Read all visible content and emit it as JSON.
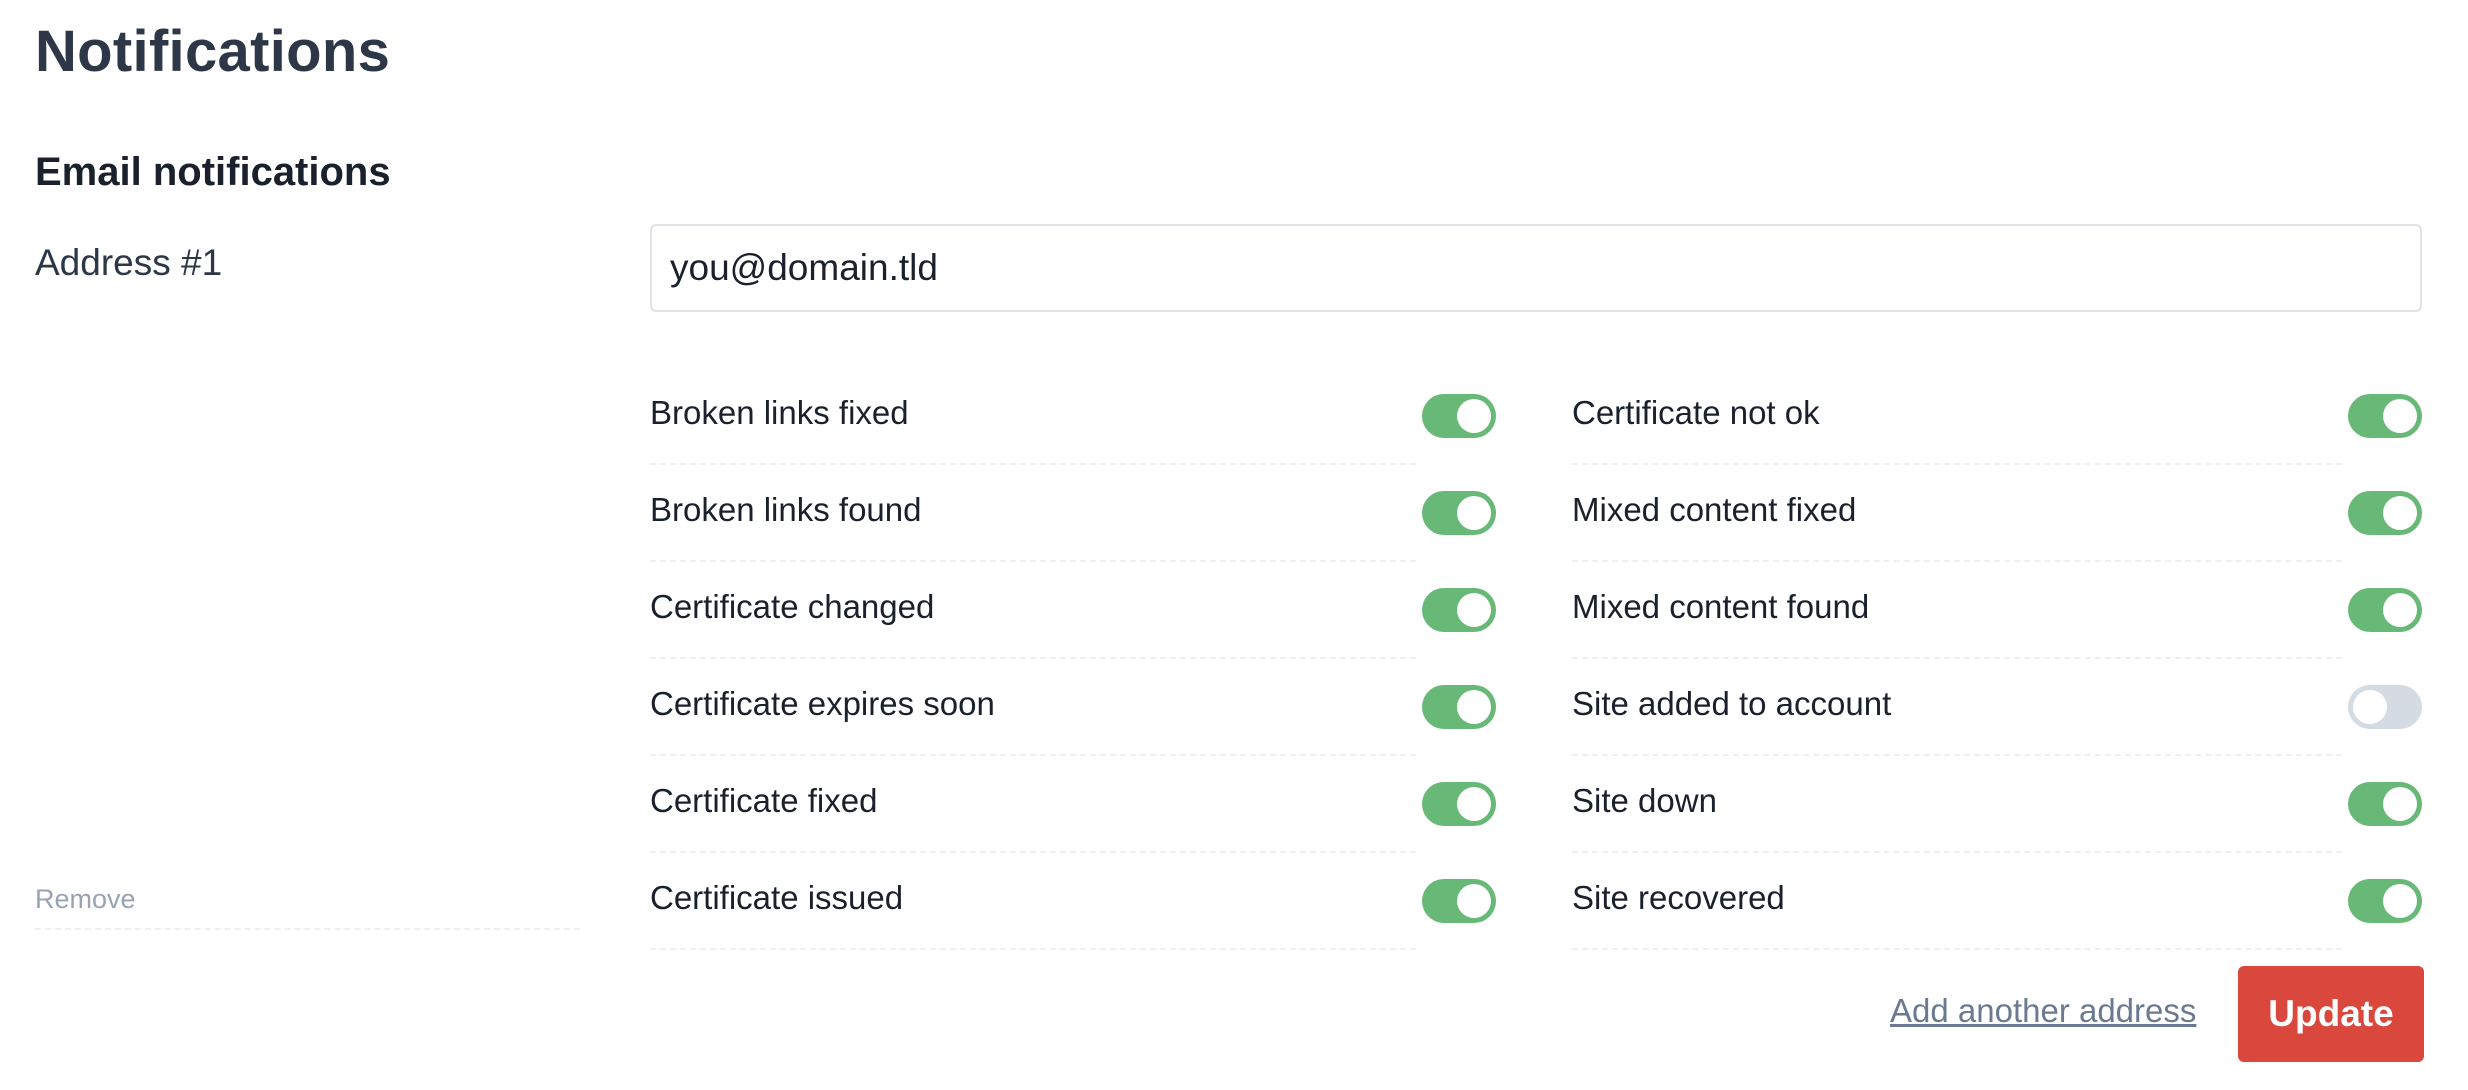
{
  "page": {
    "title": "Notifications"
  },
  "email_notifications": {
    "section_title": "Email notifications",
    "address": {
      "label": "Address #1",
      "value": "you@domain.tld",
      "remove_label": "Remove"
    },
    "left_column": [
      {
        "label": "Broken links fixed",
        "enabled": true
      },
      {
        "label": "Broken links found",
        "enabled": true
      },
      {
        "label": "Certificate changed",
        "enabled": true
      },
      {
        "label": "Certificate expires soon",
        "enabled": true
      },
      {
        "label": "Certificate fixed",
        "enabled": true
      },
      {
        "label": "Certificate issued",
        "enabled": true
      }
    ],
    "right_column": [
      {
        "label": "Certificate not ok",
        "enabled": true
      },
      {
        "label": "Mixed content fixed",
        "enabled": true
      },
      {
        "label": "Mixed content found",
        "enabled": true
      },
      {
        "label": "Site added to account",
        "enabled": false
      },
      {
        "label": "Site down",
        "enabled": true
      },
      {
        "label": "Site recovered",
        "enabled": true
      }
    ],
    "add_address_label": "Add another address",
    "update_label": "Update"
  },
  "colors": {
    "toggle_on": "#68b877",
    "toggle_off": "#d5dbe3",
    "update_button": "#d9473d"
  }
}
